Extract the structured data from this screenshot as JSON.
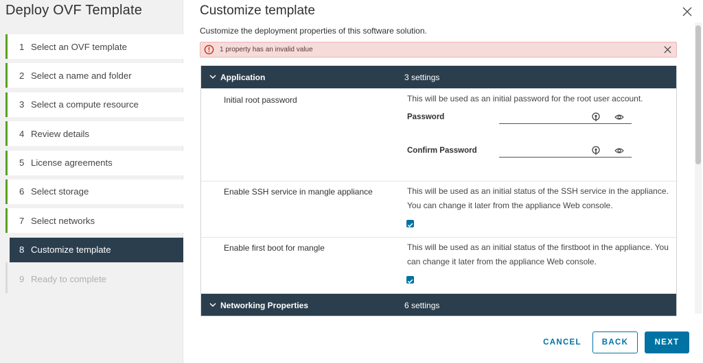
{
  "wizard": {
    "title": "Deploy OVF Template",
    "steps": [
      {
        "num": "1",
        "label": "Select an OVF template"
      },
      {
        "num": "2",
        "label": "Select a name and folder"
      },
      {
        "num": "3",
        "label": "Select a compute resource"
      },
      {
        "num": "4",
        "label": "Review details"
      },
      {
        "num": "5",
        "label": "License agreements"
      },
      {
        "num": "6",
        "label": "Select storage"
      },
      {
        "num": "7",
        "label": "Select networks"
      },
      {
        "num": "8",
        "label": "Customize template"
      },
      {
        "num": "9",
        "label": "Ready to complete"
      }
    ]
  },
  "page": {
    "title": "Customize template",
    "subtitle": "Customize the deployment properties of this software solution."
  },
  "alert": {
    "text": "1 property has an invalid value"
  },
  "groups": [
    {
      "name": "Application",
      "count": "3 settings"
    },
    {
      "name": "Networking Properties",
      "count": "6 settings"
    }
  ],
  "rows": {
    "root_password": {
      "label": "Initial root password",
      "desc": "This will be used as an initial password for the root user account.",
      "password_label": "Password",
      "password_value": "",
      "confirm_label": "Confirm Password",
      "confirm_value": ""
    },
    "ssh": {
      "label": "Enable SSH service in mangle appliance",
      "desc": "This will be used as an initial status of the SSH service in the appliance. You can change it later from the appliance Web console.",
      "checked": true
    },
    "firstboot": {
      "label": "Enable first boot for mangle",
      "desc": "This will be used as an initial status of the firstboot in the appliance. You can change it later from the appliance Web console.",
      "checked": true
    }
  },
  "footer": {
    "cancel": "CANCEL",
    "back": "BACK",
    "next": "NEXT"
  },
  "colors": {
    "header_bg": "#2b3e4e",
    "accent": "#0072a3",
    "done_bar": "#5aa220",
    "alert_bg": "#f5dbd9",
    "alert_icon": "#c92100"
  },
  "icons": [
    "close-icon",
    "error-circle-icon",
    "chevron-down-icon",
    "key-icon",
    "eye-icon",
    "checkmark-icon"
  ]
}
